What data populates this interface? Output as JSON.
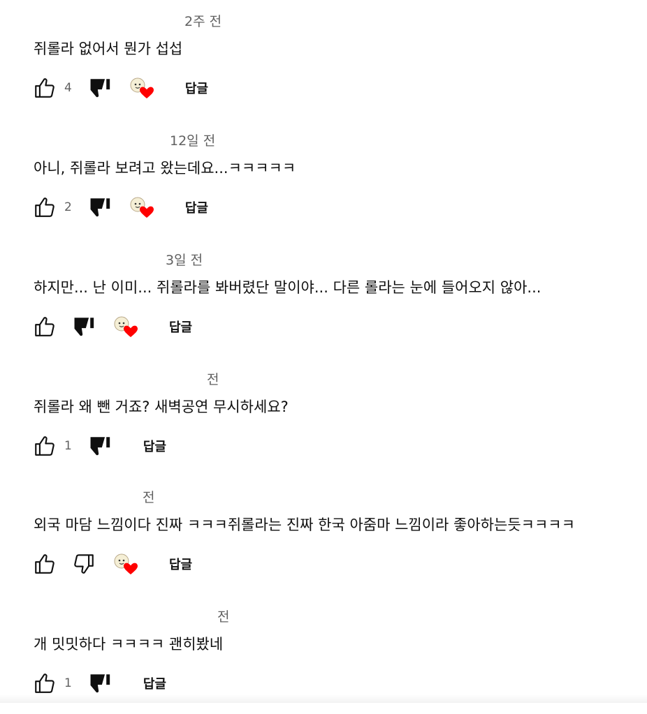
{
  "comments": [
    {
      "time": "2주 전",
      "text": "쥐롤라 없어서 뭔가 섭섭",
      "likes": "4",
      "reply_label": "답글",
      "disliked": true
    },
    {
      "time": "12일 전",
      "text": "아니, 쥐롤라 보려고 왔는데요...ㅋㅋㅋㅋㅋ",
      "likes": "2",
      "reply_label": "답글",
      "disliked": true
    },
    {
      "time": "3일 전",
      "text": "하지만... 난 이미... 쥐롤라를 봐버렸단 말이야... 다른 롤라는 눈에 들어오지 않아...",
      "likes": "",
      "reply_label": "답글",
      "disliked": true
    },
    {
      "time": "전",
      "text": "쥐롤라 왜 뺀 거죠? 새벽공연 무시하세요?",
      "likes": "1",
      "reply_label": "답글",
      "disliked": true
    },
    {
      "time": "전",
      "text": "외국 마담 느낌이다 진짜 ㅋㅋㅋ쥐롤라는 진짜 한국 아줌마 느낌이라 좋아하는듯ㅋㅋㅋㅋ",
      "likes": "",
      "reply_label": "답글",
      "disliked": false
    },
    {
      "time": "전",
      "text": "개 밋밋하다 ㅋㅋㅋㅋ 괜히봤네",
      "likes": "1",
      "reply_label": "답글",
      "disliked": true
    }
  ],
  "icons": {
    "like": "thumb-up-outline-icon",
    "dislike_filled": "thumb-down-filled-icon",
    "dislike_outline": "thumb-down-outline-icon",
    "creator_heart": "creator-heart-icon"
  },
  "colors": {
    "text": "#0f0f0f",
    "meta": "#606060",
    "heart": "#ff0000"
  }
}
